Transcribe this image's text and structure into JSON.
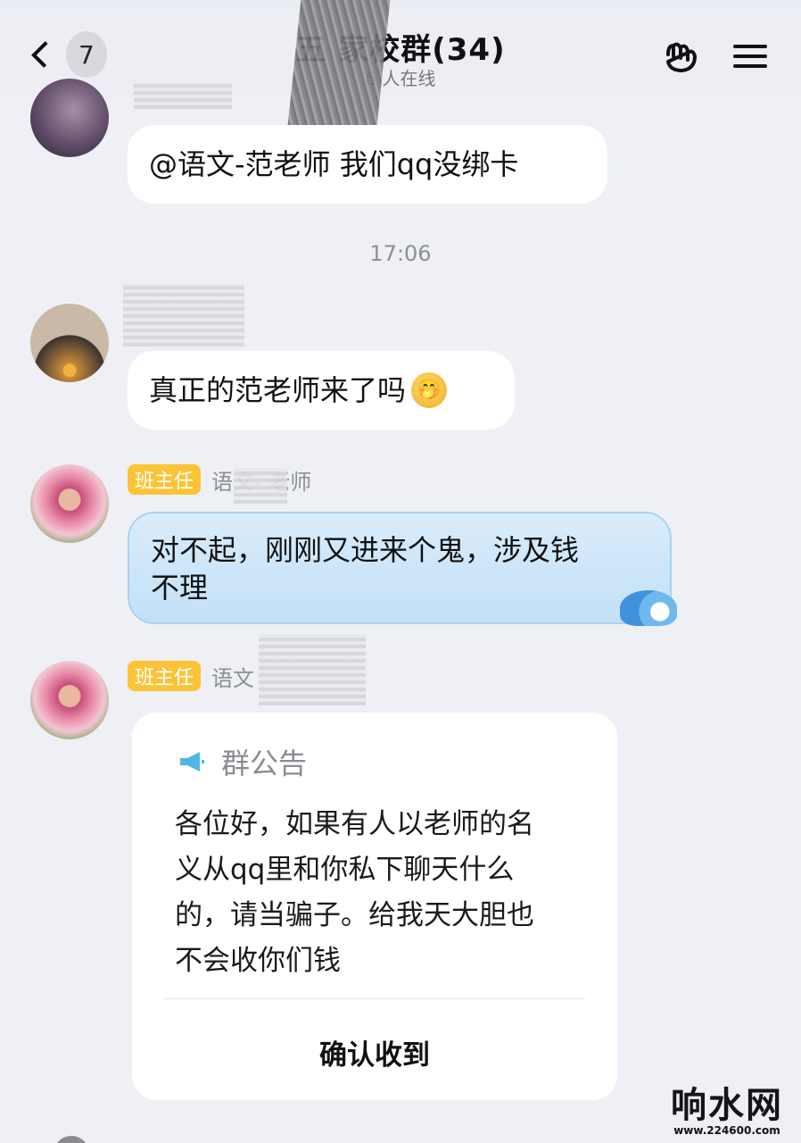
{
  "header": {
    "back_badge": "7",
    "title": "五      家校群(34)",
    "subtitle": "6 人在线",
    "icons": {
      "apps": "hand-gesture-icon",
      "menu": "menu-icon"
    }
  },
  "messages": [
    {
      "text": "@语文-范老师 我们qq没绑卡"
    },
    {
      "text": "真正的范老师来了吗",
      "emoji": "🫢"
    },
    {
      "role": "班主任",
      "sender": "语文-  老师",
      "text_line1": "对不起，刚刚又进来个鬼，涉及钱",
      "text_line2": "不理"
    },
    {
      "role": "班主任",
      "sender": "语文"
    }
  ],
  "timestamp": "17:06",
  "notice": {
    "header": "群公告",
    "body_line1": "各位好，如果有人以老师的名",
    "body_line2": "义从qq里和你私下聊天什么",
    "body_line3": "的，请当骗子。给我天大胆也",
    "body_line4": "不会收你们钱",
    "confirm": "确认收到"
  },
  "watermark": {
    "main": "响水网",
    "url": "www.224600.com"
  },
  "colors": {
    "background": "#eef0f6",
    "role_badge": "#fbc437",
    "highlight_bubble": "#c9e4f8",
    "notice_icon": "#4fb7e8"
  }
}
